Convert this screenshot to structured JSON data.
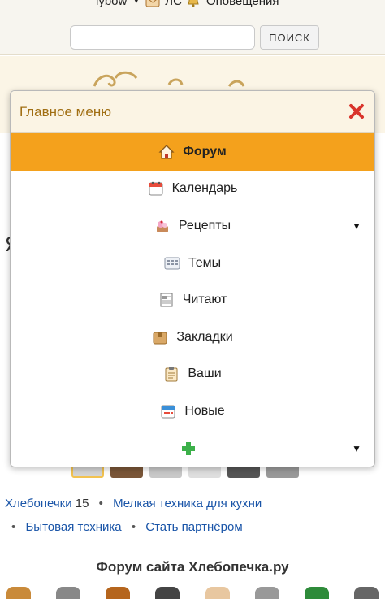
{
  "topbar": {
    "username": "lybow",
    "user_dropdown": "▼",
    "messages_label": "ЛС",
    "notifications_label": "Оповещения",
    "search_value": "",
    "search_button_label": "ПОИСК"
  },
  "menu": {
    "title": "Главное меню",
    "items": [
      {
        "label": "Форум",
        "icon": "house-icon",
        "active": true
      },
      {
        "label": "Календарь",
        "icon": "calendar-icon"
      },
      {
        "label": "Рецепты",
        "icon": "cake-icon",
        "has_submenu": true
      },
      {
        "label": "Темы",
        "icon": "topics-icon"
      },
      {
        "label": "Читают",
        "icon": "document-icon"
      },
      {
        "label": "Закладки",
        "icon": "folder-icon"
      },
      {
        "label": "Ваши",
        "icon": "clipboard-icon"
      },
      {
        "label": "Новые",
        "icon": "new-calendar-icon"
      },
      {
        "label": "",
        "icon": "plus-icon",
        "has_submenu": true
      }
    ],
    "submenu_arrow": "▼"
  },
  "background": {
    "side_letter": "Я",
    "link_line_1": {
      "link1": "Хлебопечки",
      "count": "15",
      "link2": "Мелкая техника для кухни"
    },
    "link_line_2": {
      "link1": "Бытовая техника",
      "link2": "Стать партнёром"
    },
    "bullet": "•",
    "forum_title": "Форум сайта Хлебопечка.ру"
  },
  "colors": {
    "accent": "#f4a11c",
    "menu_title": "#a06e12",
    "link": "#1a55a8",
    "close": "#d9342b"
  }
}
